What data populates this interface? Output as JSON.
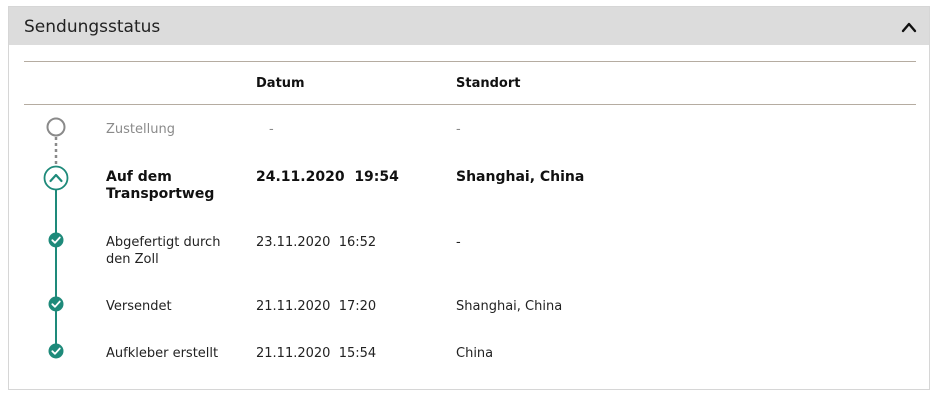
{
  "header": {
    "title": "Sendungsstatus",
    "collapse_icon": "chevron-up-icon"
  },
  "table": {
    "columns": [
      "Datum",
      "Standort"
    ],
    "rows": [
      {
        "status": "Zustellung",
        "datum": "-",
        "standort": "-",
        "state": "pending",
        "icon": "empty-circle-icon"
      },
      {
        "status": "Auf dem Transportweg",
        "datum": "24.11.2020  19:54",
        "standort": "Shanghai, China",
        "state": "current",
        "icon": "chevron-up-circle-icon"
      },
      {
        "status": "Abgefertigt durch den Zoll",
        "datum": "23.11.2020  16:52",
        "standort": "-",
        "state": "done",
        "icon": "check-circle-icon"
      },
      {
        "status": "Versendet",
        "datum": "21.11.2020  17:20",
        "standort": "Shanghai, China",
        "state": "done",
        "icon": "check-circle-icon"
      },
      {
        "status": "Aufkleber erstellt",
        "datum": "21.11.2020  15:54",
        "standort": "China",
        "state": "done",
        "icon": "check-circle-icon"
      }
    ]
  },
  "colors": {
    "accent": "#1e8a7a",
    "pending": "#8a8a8a",
    "header_bg": "#dcdcdc",
    "rule": "#b5aca1"
  }
}
